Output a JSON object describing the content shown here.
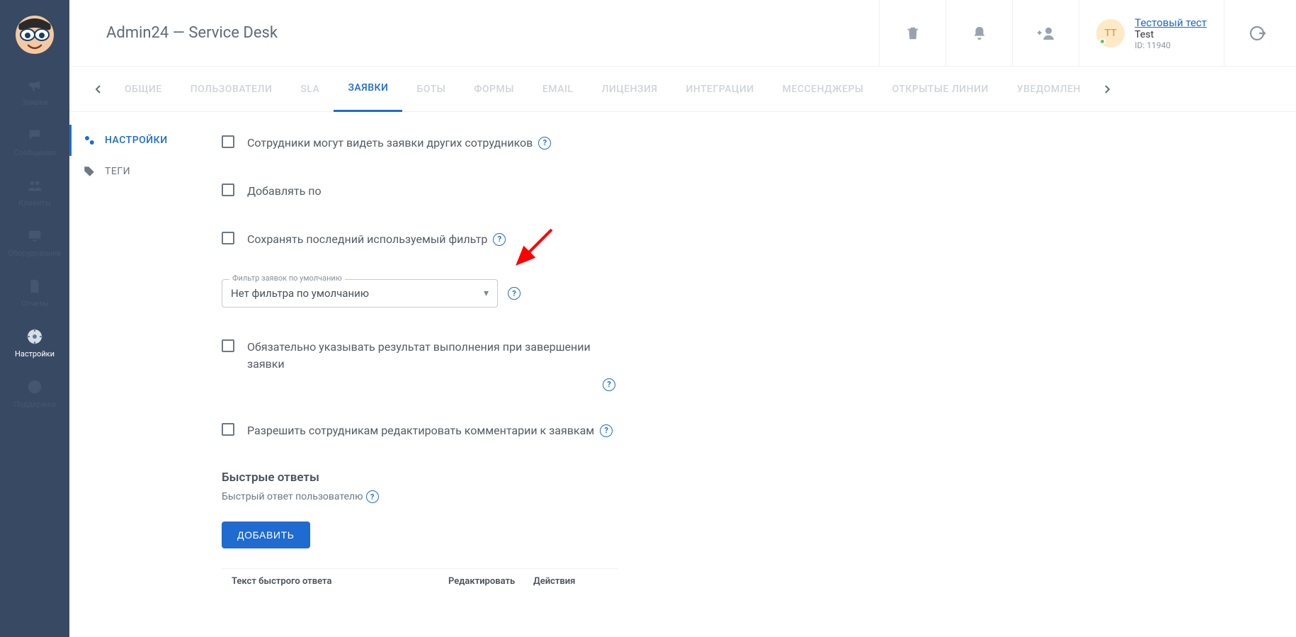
{
  "header": {
    "title": "Admin24 — Service Desk",
    "user": {
      "initials": "ТТ",
      "name": "Тестовый тест",
      "role": "Test",
      "id_label": "ID: 11940"
    }
  },
  "sidebar": {
    "items": [
      {
        "label": "Заявки"
      },
      {
        "label": "Сообщения"
      },
      {
        "label": "Клиенты"
      },
      {
        "label": "Оборудование"
      },
      {
        "label": "Отчеты"
      },
      {
        "label": "Настройки"
      },
      {
        "label": "Поддержка"
      }
    ]
  },
  "tabs": {
    "items": [
      {
        "label": "ОБЩИЕ"
      },
      {
        "label": "ПОЛЬЗОВАТЕЛИ"
      },
      {
        "label": "SLA"
      },
      {
        "label": "ЗАЯВКИ"
      },
      {
        "label": "БОТЫ"
      },
      {
        "label": "ФОРМЫ"
      },
      {
        "label": "EMAIL"
      },
      {
        "label": "ЛИЦЕНЗИЯ"
      },
      {
        "label": "ИНТЕГРАЦИИ"
      },
      {
        "label": "МЕССЕНДЖЕРЫ"
      },
      {
        "label": "ОТКРЫТЫЕ ЛИНИИ"
      },
      {
        "label": "УВЕДОМЛЕН"
      }
    ]
  },
  "submenu": {
    "items": [
      {
        "label": "НАСТРОЙКИ"
      },
      {
        "label": "ТЕГИ"
      }
    ]
  },
  "settings": {
    "row1": "Сотрудники могут видеть заявки других сотрудников",
    "row2": "Добавлять по",
    "row3": "Сохранять последний используемый фильтр",
    "select_legend": "Фильтр заявок по умолчанию",
    "select_value": "Нет фильтра по умолчанию",
    "row4": "Обязательно указывать результат выполнения при завершении заявки",
    "row5": "Разрешить сотрудникам редактировать комментарии к заявкам",
    "quick_title": "Быстрые ответы",
    "quick_sub": "Быстрый ответ пользователю",
    "add_btn": "ДОБАВИТЬ",
    "table": {
      "col_text": "Текст быстрого ответа",
      "col_edit": "Редактировать",
      "col_act": "Действия"
    }
  }
}
